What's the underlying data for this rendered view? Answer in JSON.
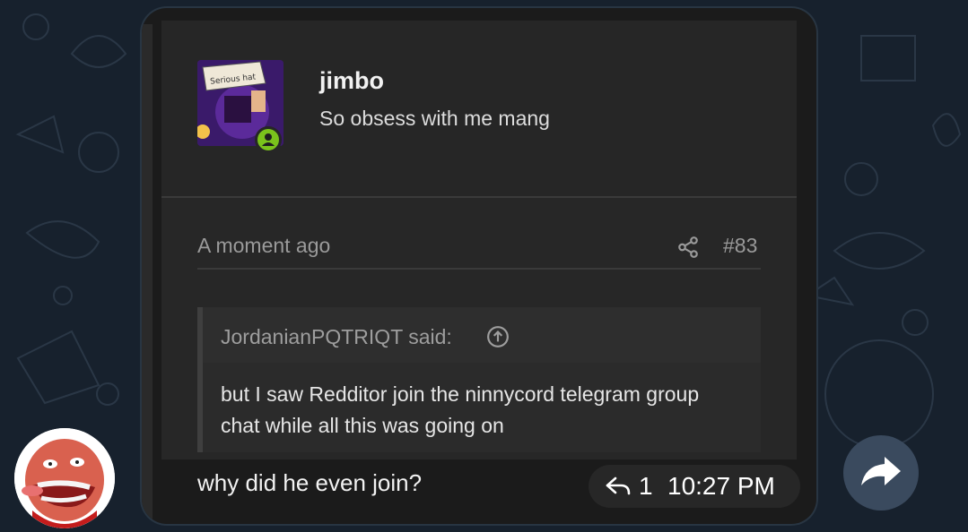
{
  "post": {
    "username": "jimbo",
    "user_title": "So obsess with me mang",
    "avatar_caption": "Serious hat",
    "timestamp": "A moment ago",
    "post_number": "#83",
    "quote": {
      "attribution": "JordanianPQTRIQT said:",
      "body": "but I saw Redditor join the ninnycord telegram group chat while all this was going on"
    }
  },
  "message": {
    "text": "why did he even join?",
    "reply_count": "1",
    "time": "10:27 PM"
  },
  "colors": {
    "online_dot": "#7ac21c",
    "bubble_bg": "#1b1b1b",
    "chat_bg": "#17212d"
  },
  "icons": {
    "share": "share-icon",
    "jump_to_quote": "arrow-up-circle-icon",
    "reply": "reply-arrow-icon",
    "forward": "forward-arrow-icon"
  }
}
